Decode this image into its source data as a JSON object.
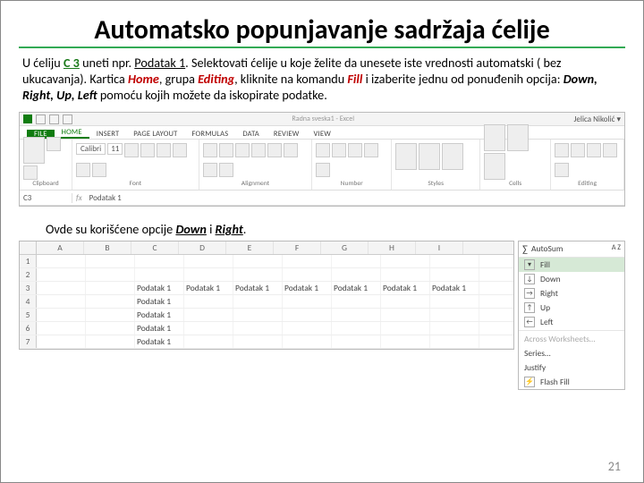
{
  "title": "Automatsko popunjavanje sadržaja ćelije",
  "para": {
    "t1": "U ćeliju ",
    "cell": "C 3",
    "t2": "  uneti npr. ",
    "pod": "Podatak 1",
    "t3": ". Selektovati ćelije u koje želite da unesete iste vrednosti automatski ( bez ukucavanja).  Kartica ",
    "home": "Home",
    "t4": ", grupa ",
    "editing": "Editing",
    "t5": ", kliknite na komandu ",
    "fill": "Fill",
    "t6": " i izaberite jednu od ponuđenih opcija: ",
    "dirs": "Down, Right, Up, Left",
    "t7": " pomoću kojih možete da iskopirate podatke."
  },
  "excel_titlebar": "Radna sveska1 - Excel",
  "tabs": [
    "FILE",
    "HOME",
    "INSERT",
    "PAGE LAYOUT",
    "FORMULAS",
    "DATA",
    "REVIEW",
    "VIEW"
  ],
  "ribbon_groups": [
    "Clipboard",
    "Font",
    "Alignment",
    "Number",
    "Styles",
    "Cells",
    "Editing"
  ],
  "font_name": "Calibri",
  "font_size": "11",
  "namebox": "C3",
  "fx": "fx",
  "formula_value": "Podatak 1",
  "signin": "Jelica Nikolić ▾",
  "caption2_a": "Ovde su korišćene opcije ",
  "caption2_b": "Down",
  "caption2_c": " i ",
  "caption2_d": "Right",
  "caption2_e": ".",
  "sheet2": {
    "cols": [
      "A",
      "B",
      "C",
      "D",
      "E",
      "F",
      "G",
      "H",
      "I"
    ],
    "rows": [
      "1",
      "2",
      "3",
      "4",
      "5",
      "6",
      "7"
    ],
    "data": {
      "3": {
        "C": "Podatak 1",
        "D": "Podatak 1",
        "E": "Podatak 1",
        "F": "Podatak 1",
        "G": "Podatak 1",
        "H": "Podatak 1",
        "I": "Podatak 1"
      },
      "4": {
        "C": "Podatak 1"
      },
      "5": {
        "C": "Podatak 1"
      },
      "6": {
        "C": "Podatak 1"
      },
      "7": {
        "C": "Podatak 1"
      }
    }
  },
  "fill_menu": {
    "autosum": "AutoSum",
    "fill": "Fill",
    "sort": "A Z",
    "items": [
      "Down",
      "Right",
      "Up",
      "Left"
    ],
    "across": "Across Worksheets…",
    "series": "Series…",
    "justify": "Justify",
    "flash": "Flash Fill"
  },
  "arrow": {
    "down": "↓",
    "right": "→",
    "up": "↑",
    "left": "←"
  },
  "pagenum": "21"
}
